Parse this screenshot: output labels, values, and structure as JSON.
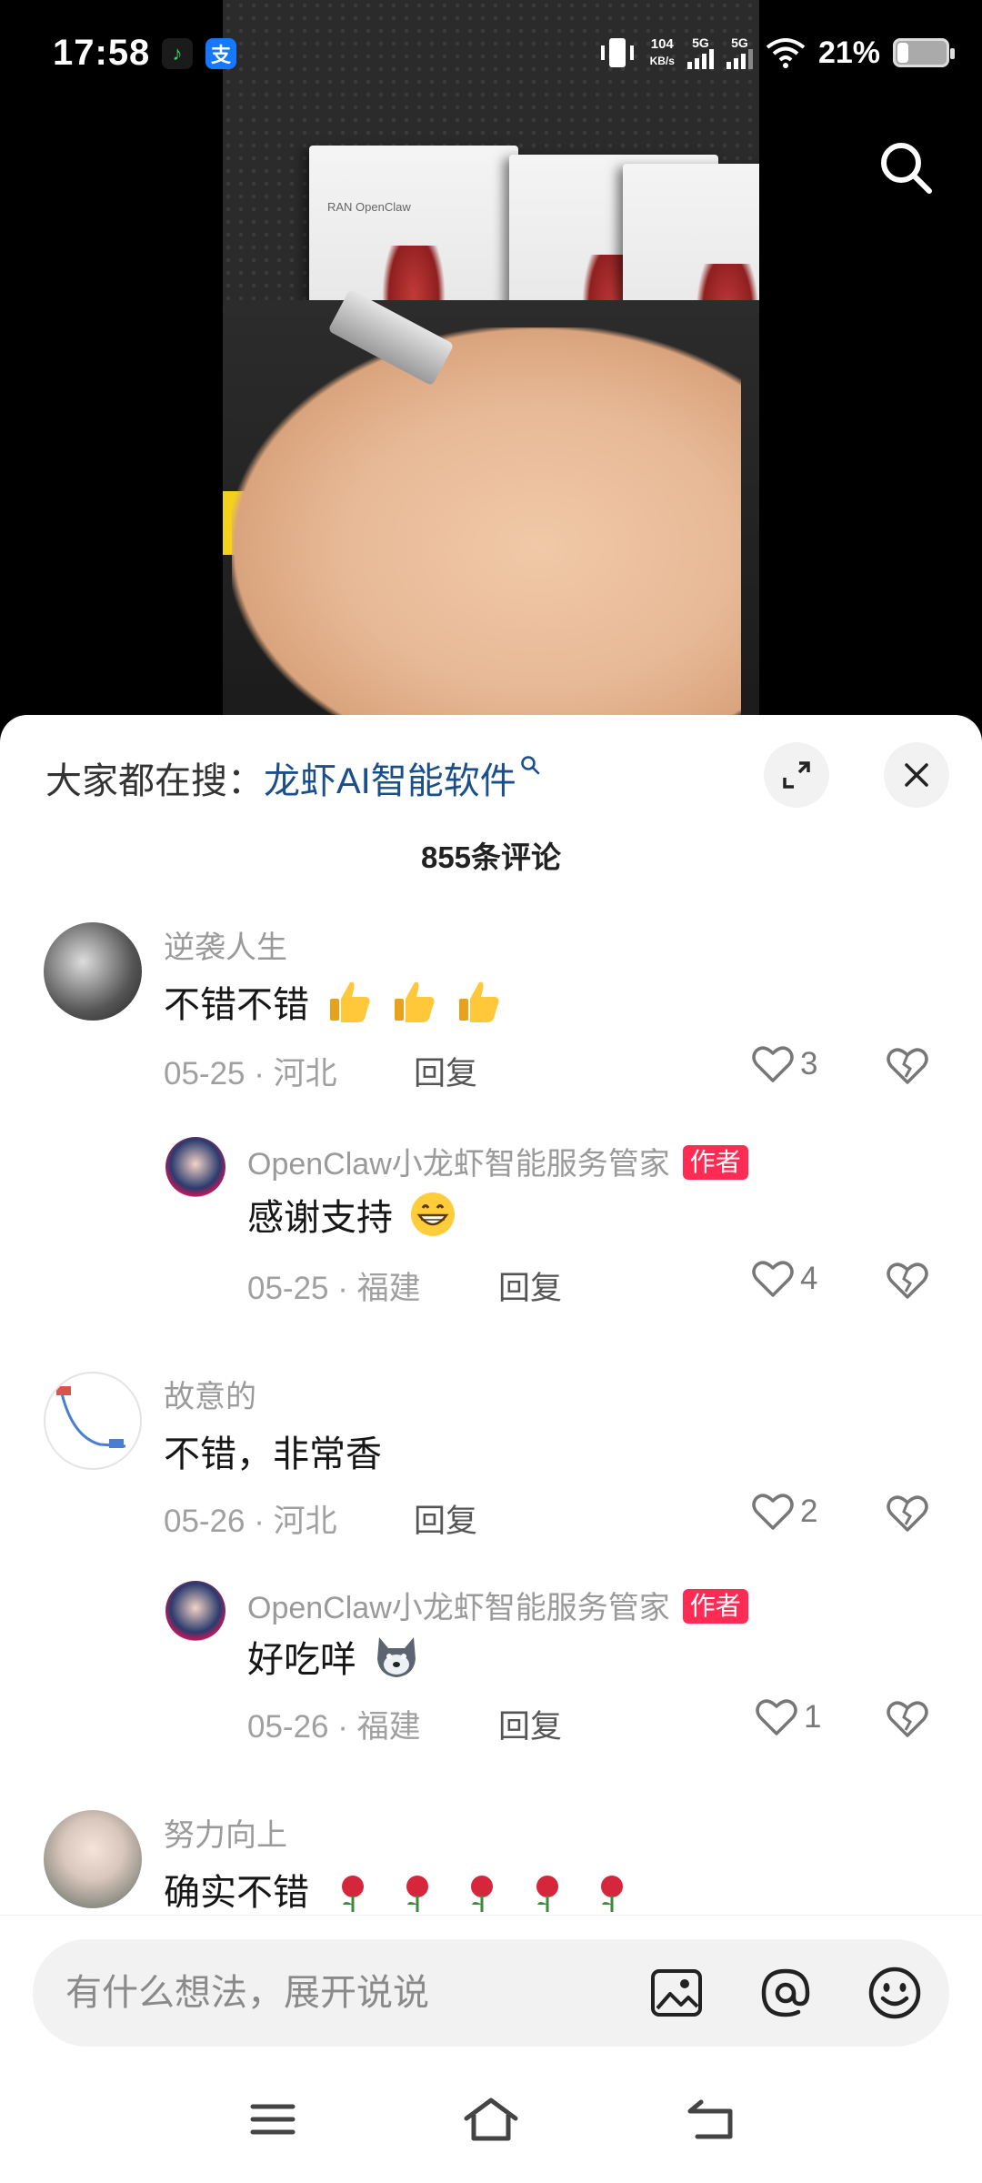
{
  "status_bar": {
    "time": "17:58",
    "app_badges": [
      "music-app",
      "alipay"
    ],
    "alipay_glyph": "支",
    "net_speed_value": "104",
    "net_speed_unit": "KB/s",
    "signal1_label": "5G",
    "signal2_label": "5G",
    "battery_percent": "21%",
    "battery_level": 0.21
  },
  "sheet": {
    "search_prefix": "大家都在搜：",
    "search_keyword": "龙虾AI智能软件",
    "comment_count": "855条评论"
  },
  "comments": [
    {
      "user": "逆袭人生",
      "text": "不错不错",
      "emoji": [
        "thumbs-up",
        "thumbs-up",
        "thumbs-up"
      ],
      "date": "05-25",
      "region": "河北",
      "reply_label": "回复",
      "likes": "3",
      "reply": {
        "user": "OpenClaw小龙虾智能服务管家",
        "badge": "作者",
        "text": "感谢支持",
        "emoji": [
          "grin"
        ],
        "date": "05-25",
        "region": "福建",
        "reply_label": "回复",
        "likes": "4"
      }
    },
    {
      "user": "故意的",
      "text": "不错，非常香",
      "date": "05-26",
      "region": "河北",
      "reply_label": "回复",
      "likes": "2",
      "reply": {
        "user": "OpenClaw小龙虾智能服务管家",
        "badge": "作者",
        "text": "好吃咩",
        "emoji": [
          "husky"
        ],
        "date": "05-26",
        "region": "福建",
        "reply_label": "回复",
        "likes": "1"
      }
    },
    {
      "user": "努力向上",
      "text": "确实不错",
      "emoji": [
        "rose",
        "rose",
        "rose",
        "rose",
        "rose"
      ]
    }
  ],
  "meta_separator": "·",
  "input": {
    "placeholder": "有什么想法，展开说说"
  },
  "icons": {
    "top_right": "search-icon",
    "expand": "expand-icon",
    "close": "close-icon",
    "like": "heart-outline-icon",
    "dislike": "broken-heart-icon",
    "image": "image-icon",
    "mention": "at-icon",
    "emoji": "smiley-icon",
    "nav": [
      "menu-icon",
      "home-icon",
      "back-icon"
    ]
  },
  "colors": {
    "keyword": "#1a4f8b",
    "author_badge": "#fe2c55",
    "sheet_bg": "#ffffff",
    "input_bg": "#f2f2f2"
  }
}
